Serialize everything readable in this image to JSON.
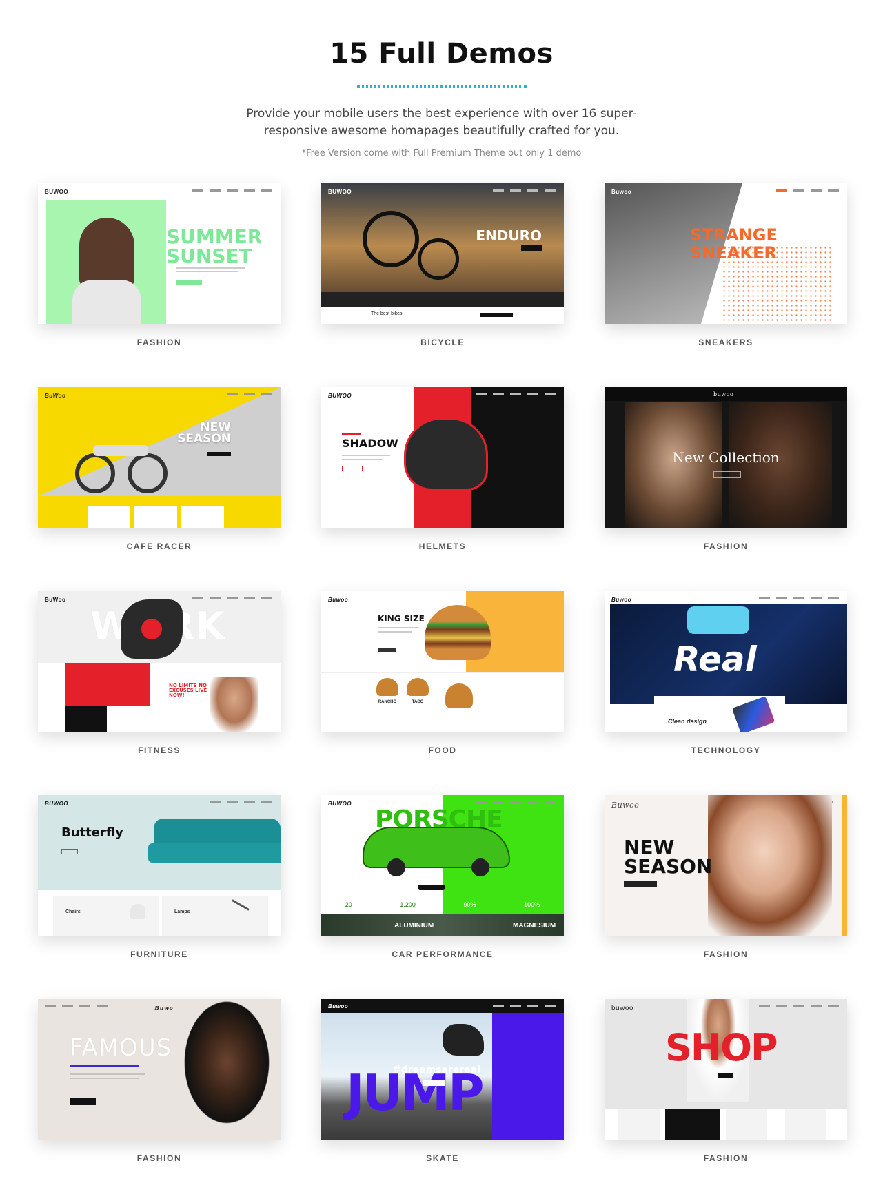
{
  "header": {
    "title": "15 Full Demos",
    "subtitle": "Provide your mobile users the best experience with over 16 super-responsive awesome homapages beautifully crafted for you.",
    "note": "*Free Version come with Full Premium Theme but only 1 demo"
  },
  "accent_color": "#2bb3c9",
  "demos": [
    {
      "label": "FASHION",
      "logo": "BUWOO",
      "headline": "SUMMER SUNSET"
    },
    {
      "label": "BICYCLE",
      "logo": "BUWOO",
      "headline": "ENDURO",
      "footer_text": "The best bikes"
    },
    {
      "label": "SNEAKERS",
      "logo": "Buwoo",
      "headline": "STRANGE SNEAKER"
    },
    {
      "label": "CAFE RACER",
      "logo": "BuWoo",
      "headline": "NEW SEASON"
    },
    {
      "label": "HELMETS",
      "logo": "BUWOO",
      "headline": "SHADOW"
    },
    {
      "label": "FASHION",
      "logo": "buwoo",
      "headline": "New Collection"
    },
    {
      "label": "FITNESS",
      "logo": "BuWoo",
      "headline": "WORK",
      "sub_headline": "NO LIMITS NO EXCUSES LIVE NOW!"
    },
    {
      "label": "FOOD",
      "logo": "Buwoo",
      "headline": "KING SIZE",
      "items": [
        "RANCHO",
        "TACO"
      ]
    },
    {
      "label": "TECHNOLOGY",
      "logo": "Buwoo",
      "headline": "Real",
      "caption": "Clean design"
    },
    {
      "label": "FURNITURE",
      "logo": "BUWOO",
      "headline": "Butterfly",
      "items": [
        "Chairs",
        "Lamps"
      ]
    },
    {
      "label": "CAR PERFORMANCE",
      "logo": "BUWOO",
      "headline": "PORSCHE",
      "stats": [
        "20",
        "1,200",
        "90%",
        "100%"
      ],
      "strip": [
        "ALUMINIUM",
        "MAGNESIUM"
      ]
    },
    {
      "label": "FASHION",
      "logo": "Buwoo",
      "headline": "NEW SEASON"
    },
    {
      "label": "FASHION",
      "logo": "Buwoo",
      "headline": "FAMOUS"
    },
    {
      "label": "SKATE",
      "logo": "Buwoo",
      "headline": "JUMP",
      "tag": "#dreamsarereal"
    },
    {
      "label": "FASHION",
      "logo": "buwoo",
      "headline": "SHOP"
    }
  ]
}
